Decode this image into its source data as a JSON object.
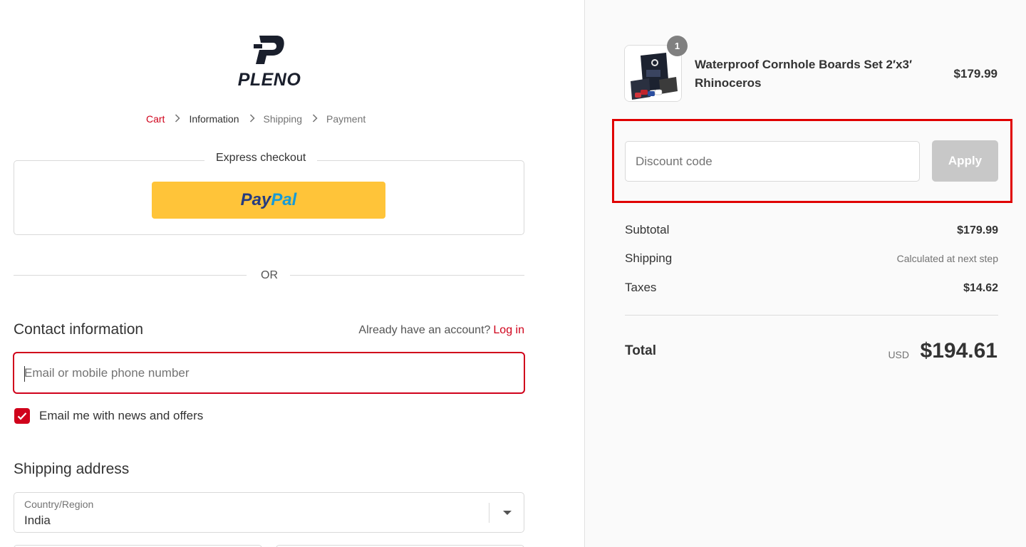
{
  "brand": {
    "name": "PLENO"
  },
  "breadcrumb": {
    "items": [
      {
        "label": "Cart",
        "state": "link"
      },
      {
        "label": "Information",
        "state": "current"
      },
      {
        "label": "Shipping",
        "state": "upcoming"
      },
      {
        "label": "Payment",
        "state": "upcoming"
      }
    ],
    "separator_icon": "chevron-right-icon"
  },
  "express_checkout": {
    "title": "Express checkout",
    "paypal_pay": "Pay",
    "paypal_pal": "Pal"
  },
  "divider": {
    "or_label": "OR"
  },
  "contact": {
    "title": "Contact information",
    "account_prompt": "Already have an account?",
    "login_label": "Log in",
    "email_placeholder": "Email or mobile phone number",
    "newsletter_label": "Email me with news and offers",
    "newsletter_checked": true
  },
  "shipping": {
    "title": "Shipping address",
    "country_label": "Country/Region",
    "country_value": "India"
  },
  "order": {
    "item": {
      "name": "Waterproof Cornhole Boards Set 2′x3′ Rhinoceros",
      "quantity": "1",
      "price": "$179.99"
    },
    "discount": {
      "placeholder": "Discount code",
      "apply_label": "Apply"
    },
    "summary": {
      "subtotal_label": "Subtotal",
      "subtotal_value": "$179.99",
      "shipping_label": "Shipping",
      "shipping_value": "Calculated at next step",
      "taxes_label": "Taxes",
      "taxes_value": "$14.62",
      "total_label": "Total",
      "total_currency": "USD",
      "total_value": "$194.61"
    }
  },
  "colors": {
    "accent": "#d0021b",
    "highlight": "#e00000",
    "paypal_yellow": "#ffc439",
    "apply_disabled": "#c8c8c8",
    "sidebar_bg": "#fafafa"
  }
}
